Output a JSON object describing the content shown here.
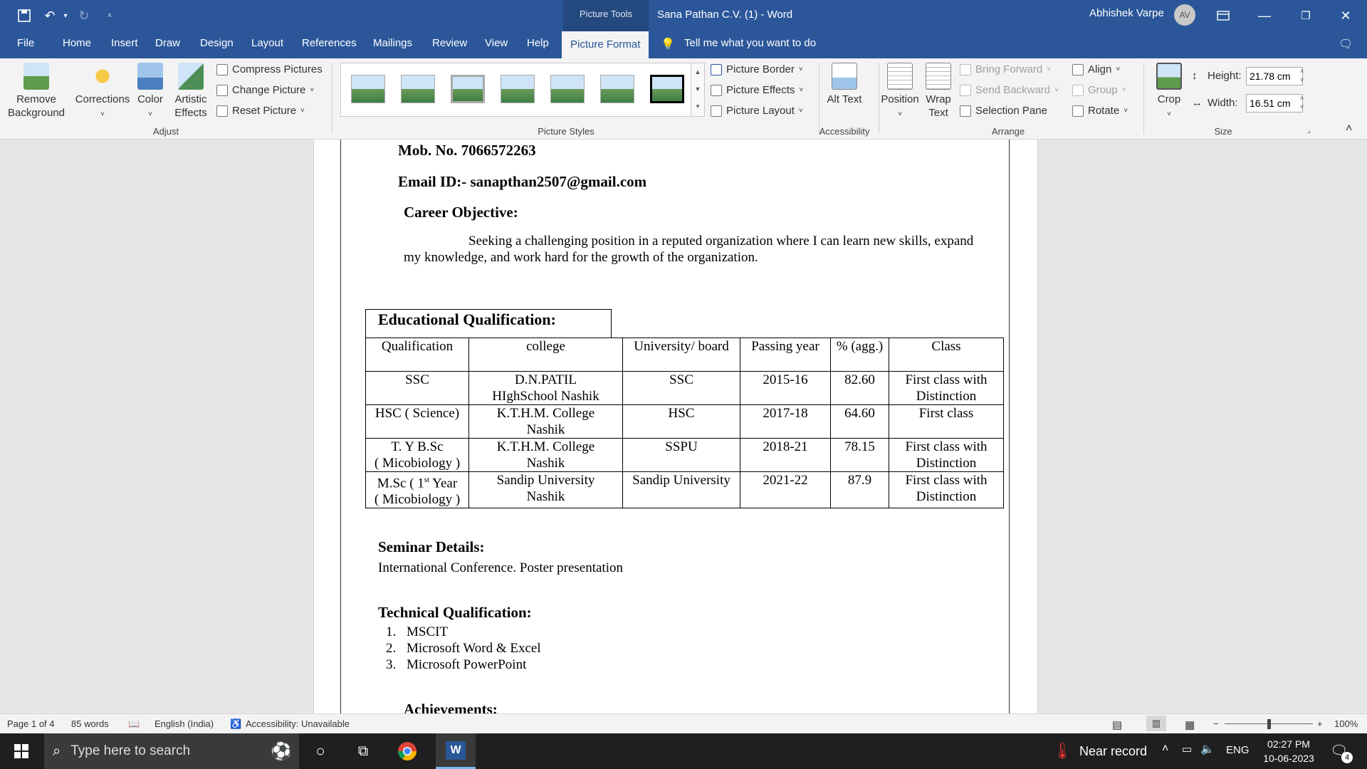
{
  "titlebar": {
    "doc_title": "Sana Pathan C.V. (1)  -  Word",
    "tools_label": "Picture Tools",
    "user_name": "Abhishek Varpe",
    "user_initials": "AV"
  },
  "tabs": [
    "File",
    "Home",
    "Insert",
    "Draw",
    "Design",
    "Layout",
    "References",
    "Mailings",
    "Review",
    "View",
    "Help",
    "Picture Format"
  ],
  "tell_me": "Tell me what you want to do",
  "ribbon": {
    "adjust": {
      "remove_bg": "Remove Background",
      "corrections": "Corrections",
      "color": "Color",
      "artistic": "Artistic Effects",
      "compress": "Compress Pictures",
      "change": "Change Picture",
      "reset": "Reset Picture",
      "label": "Adjust"
    },
    "styles": {
      "border": "Picture Border",
      "effects": "Picture Effects",
      "layout": "Picture Layout",
      "label": "Picture Styles"
    },
    "access": {
      "alt": "Alt Text",
      "label": "Accessibility"
    },
    "arrange": {
      "position": "Position",
      "wrap": "Wrap Text",
      "bring": "Bring Forward",
      "send": "Send Backward",
      "pane": "Selection Pane",
      "align": "Align",
      "group": "Group",
      "rotate": "Rotate",
      "label": "Arrange"
    },
    "size": {
      "crop": "Crop",
      "height_label": "Height:",
      "height_val": "21.78 cm",
      "width_label": "Width:",
      "width_val": "16.51 cm",
      "label": "Size"
    }
  },
  "doc": {
    "mob": "Mob. No. 7066572263",
    "email": "Email ID:- sanapthan2507@gmail.com",
    "career_heading": "Career Objective:",
    "career_line1": "Seeking a challenging position in a reputed organization where I can learn new skills, expand",
    "career_line2": "my  knowledge, and work hard for the growth of the organization.",
    "edu_heading": "Educational Qualification:",
    "table_headers": [
      "Qualification",
      "college",
      "University/ board",
      "Passing year",
      "% (agg.)",
      "Class"
    ],
    "rows": [
      {
        "q": "SSC",
        "c1": "D.N.PATIL",
        "c2": "HIghSchool Nashik",
        "u": "SSC",
        "y": "2015-16",
        "p": "82.60",
        "k1": "First class with",
        "k2": "Distinction"
      },
      {
        "q": "HSC ( Science)",
        "c1": "K.T.H.M. College",
        "c2": "Nashik",
        "u": "HSC",
        "y": "2017-18",
        "p": "64.60",
        "k1": "First class",
        "k2": ""
      },
      {
        "q": "T.  Y B.Sc",
        "q2": "( Micobiology )",
        "c1": "K.T.H.M. College",
        "c2": "Nashik",
        "u": "SSPU",
        "y": "2018-21",
        "p": "78.15",
        "k1": "First class with",
        "k2": "Distinction"
      },
      {
        "q": "M.Sc ( 1",
        "sup": "st",
        "qrest": " Year",
        "q2": "( Micobiology )",
        "c1": "Sandip University",
        "c2": "Nashik",
        "u": "Sandip University",
        "y": "2021-22",
        "p": "87.9",
        "k1": "First class with",
        "k2": "Distinction"
      }
    ],
    "seminar_heading": "Seminar Details:",
    "seminar_text": "International Conference. Poster presentation",
    "tech_heading": "Technical Qualification:",
    "tech_items": [
      "MSCIT",
      "Microsoft Word & Excel",
      "Microsoft PowerPoint"
    ],
    "ach_heading": "Achievements:"
  },
  "status": {
    "page": "Page 1 of 4",
    "words": "85 words",
    "lang": "English (India)",
    "access": "Accessibility: Unavailable",
    "zoom": "100%"
  },
  "taskbar": {
    "search": "Type here to search",
    "weather": "Near record",
    "lang": "ENG",
    "time": "02:27 PM",
    "date": "10-06-2023",
    "notif": "4"
  }
}
